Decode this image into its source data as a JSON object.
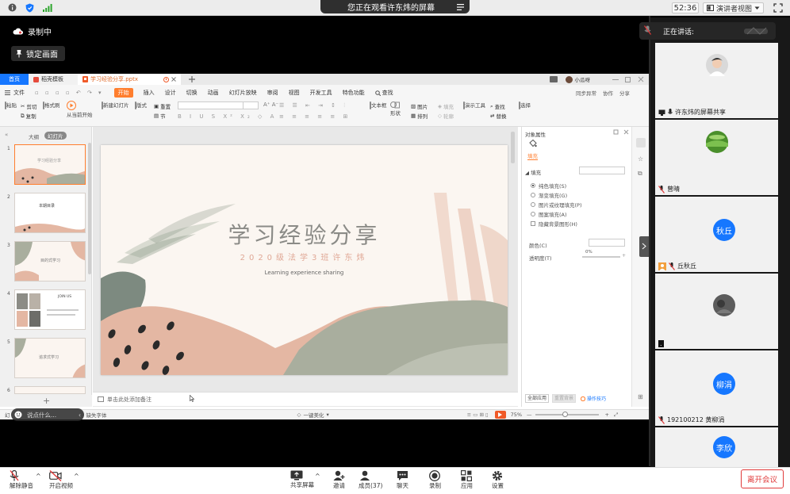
{
  "top_bar": {
    "share_banner": "您正在观看许东炜的屏幕",
    "timer": "52:36",
    "view_mode": "演讲者视图"
  },
  "recording": {
    "label": "录制中",
    "lock_screen": "锁定画面"
  },
  "wps": {
    "tabs": [
      {
        "label": "首页"
      },
      {
        "label": "稻壳模板"
      },
      {
        "label": "学习经验分享.pptx"
      }
    ],
    "user_name": "小瓜呀",
    "ribbon_tabs": [
      "文件",
      "开始",
      "插入",
      "设计",
      "切换",
      "动画",
      "幻灯片放映",
      "审阅",
      "视图",
      "开发工具",
      "特色功能",
      "查找"
    ],
    "ribbon_right": [
      "同步异常",
      "协作",
      "分享"
    ],
    "tools": {
      "paste": "粘贴",
      "cut": "剪切",
      "copy": "复制",
      "format_painter": "格式刷",
      "from_current": "从当前开始",
      "new_slide": "新建幻灯片",
      "layout": "版式",
      "section": "节",
      "reset": "重置",
      "textbox": "文本框",
      "shape": "形状",
      "arrange": "排列",
      "image": "图片",
      "fill": "填充",
      "outline": "轮廓",
      "presenter_tools": "演示工具",
      "find": "查找",
      "replace": "替换",
      "select": "选择"
    },
    "outline_tabs": [
      "大纲",
      "幻灯片"
    ],
    "thumbnails": [
      {
        "num": "1",
        "title": "学习经验分享"
      },
      {
        "num": "2",
        "title": "本期目录"
      },
      {
        "num": "3",
        "title": "目的式学习"
      },
      {
        "num": "4",
        "title": "JOIN US"
      },
      {
        "num": "5",
        "title": "追求式学习"
      },
      {
        "num": "6",
        "title": ""
      }
    ],
    "slide": {
      "title": "学习经验分享",
      "subtitle": "2020级法学3班许东炜",
      "english": "Learning experience sharing"
    },
    "notes_placeholder": "单击此处添加备注",
    "properties": {
      "panel_title": "对象属性",
      "fill_tab": "填充",
      "fill_section": "填充",
      "fill_options": [
        "纯色填充(S)",
        "渐变填充(G)",
        "图片或纹理填充(P)",
        "图案填充(A)"
      ],
      "hide_bg": "隐藏背景图形(H)",
      "color_label": "颜色(C)",
      "transparency_label": "透明度(T)",
      "transparency_value": "0%",
      "apply_all": "全部应用",
      "reset_bg": "重置背景",
      "tips": "操作技巧"
    },
    "status": {
      "left": "幻",
      "missing_font": "缺失字体",
      "beautify": "一键美化",
      "zoom": "75%",
      "say_something": "说点什么..."
    }
  },
  "participants": {
    "speaking_label": "正在讲话:",
    "list": [
      {
        "name": "许东炜的屏幕共享",
        "avatar_text": "",
        "type": "photo"
      },
      {
        "name": "曾晴",
        "avatar_text": "",
        "type": "photo"
      },
      {
        "name": "丘秋丘",
        "avatar_text": "秋丘",
        "type": "initials"
      },
      {
        "name": ".",
        "avatar_text": "",
        "type": "photo"
      },
      {
        "name": "192100212 黄柳涓",
        "avatar_text": "柳涓",
        "type": "initials"
      },
      {
        "name": "",
        "avatar_text": "李欣",
        "type": "initials"
      }
    ]
  },
  "bottom_bar": {
    "mute": "解除静音",
    "video": "开启视频",
    "share": "共享屏幕",
    "invite": "邀请",
    "members": "成员(37)",
    "chat": "聊天",
    "record": "录制",
    "apps": "应用",
    "settings": "设置",
    "leave": "离开会议"
  },
  "colors": {
    "accent_orange": "#f05a28",
    "wps_orange": "#ff7e2e",
    "avatar_blue": "#1677ff",
    "leave_red": "#e03a3a",
    "slide_title": "#8b8b87",
    "slide_subtitle": "#e0a896",
    "blob_green": "#a9ae9e",
    "blob_pink": "#e4b7a3"
  }
}
